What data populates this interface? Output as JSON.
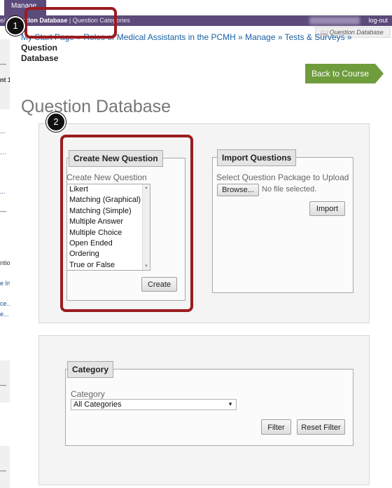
{
  "nav": {
    "manage_tab": "Manage",
    "tabs_prefix": "e",
    "tabs_sep1": "/ | ",
    "active_tab": "Question Database",
    "tabs_sep2": " | ",
    "tab_categories": "Question Categories",
    "logout": "log-out"
  },
  "help": {
    "label": "Question Database",
    "icon": "book-icon"
  },
  "breadcrumb": {
    "text": "My Start Page » Roles of Medical Assistants in the PCMH » Manage » Tests & Surveys » ",
    "current_line1": "Question",
    "current_line2": "Database"
  },
  "back_button": "Back to Course",
  "page_title": "Question Database",
  "create_panel": {
    "legend": "Create New Question",
    "label": "Create New Question",
    "options": [
      "Likert",
      "Matching (Graphical)",
      "Matching (Simple)",
      "Multiple Answer",
      "Multiple Choice",
      "Open Ended",
      "Ordering",
      "True or False"
    ],
    "create_button": "Create"
  },
  "import_panel": {
    "legend": "Import Questions",
    "label": "Select Question Package to Upload",
    "browse_button": "Browse...",
    "file_status": "No file selected.",
    "import_button": "Import"
  },
  "category_panel": {
    "legend": "Category",
    "label": "Category",
    "selected": "All Categories",
    "filter_button": "Filter",
    "reset_button": "Reset Filter"
  },
  "sidebar_fragments": [
    "—",
    "nt 1",
    "...",
    "…",
    "...",
    "—",
    "ntio",
    "e In",
    "ce...",
    "e...",
    "—",
    "—"
  ],
  "annotations": {
    "marker1": "1",
    "marker2": "2",
    "highlight_color": "#9b1b1f"
  },
  "colors": {
    "nav_bar": "#5c4a7a",
    "back_button": "#6f9c3c"
  }
}
